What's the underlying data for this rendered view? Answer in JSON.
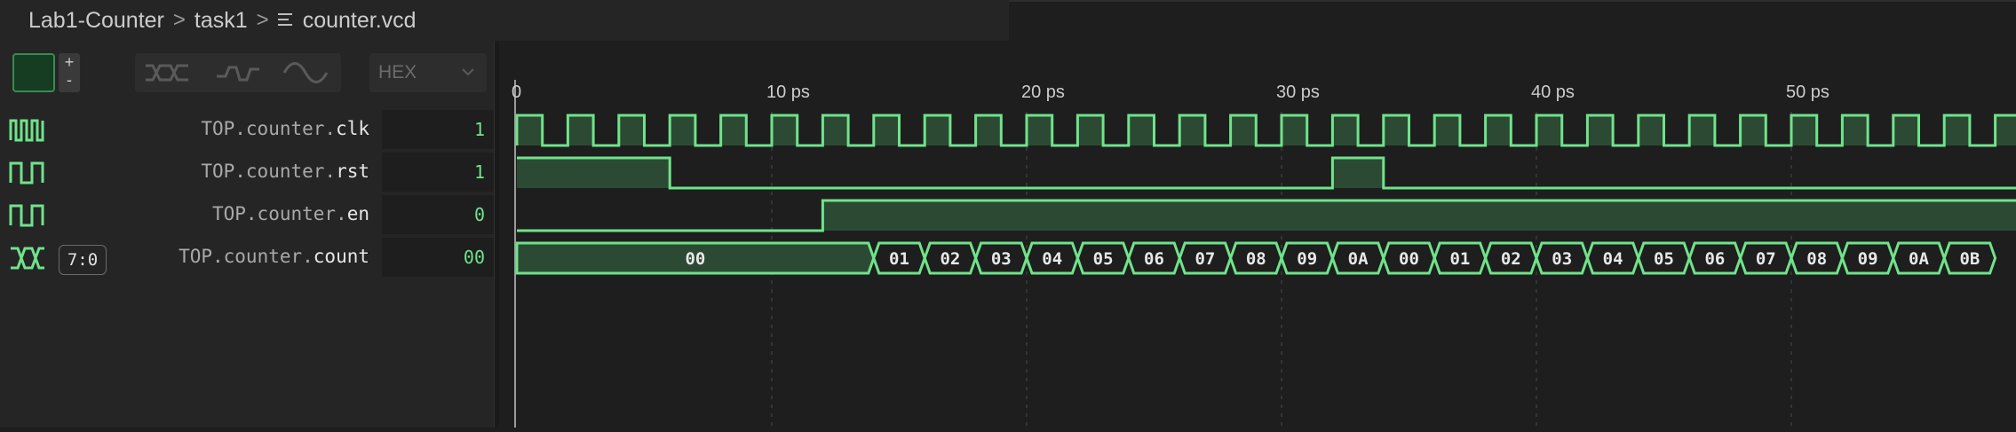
{
  "breadcrumb": {
    "items": [
      "Lab1-Counter",
      "task1",
      "counter.vcd"
    ],
    "separator": ">"
  },
  "toolbar": {
    "plus": "+",
    "minus": "-",
    "radix": "HEX",
    "tools": [
      "bus-style-icon",
      "digital-style-icon",
      "analog-style-icon"
    ]
  },
  "ruler": {
    "ticks": [
      "0",
      "10 ps",
      "20 ps",
      "30 ps",
      "40 ps",
      "50 ps"
    ],
    "unit": "ps"
  },
  "signals": [
    {
      "prefix": "TOP.counter.",
      "name": "clk",
      "value": "1",
      "icon": "clock-wave-icon"
    },
    {
      "prefix": "TOP.counter.",
      "name": "rst",
      "value": "1",
      "icon": "digital-wave-icon"
    },
    {
      "prefix": "TOP.counter.",
      "name": "en",
      "value": "0",
      "icon": "digital-wave-icon"
    },
    {
      "prefix": "TOP.counter.",
      "name": "count",
      "value": "00",
      "icon": "bus-wave-icon",
      "range": "7:0"
    }
  ],
  "count_values": [
    "00",
    "01",
    "02",
    "03",
    "04",
    "05",
    "06",
    "07",
    "08",
    "09",
    "0A",
    "00",
    "01",
    "02",
    "03",
    "04",
    "05",
    "06",
    "07",
    "08",
    "09",
    "0A",
    "0B"
  ],
  "colors": {
    "wave": "#6fe38a",
    "wave_fill": "#2c4a33",
    "background": "#1e1e1e",
    "panel": "#252526"
  }
}
